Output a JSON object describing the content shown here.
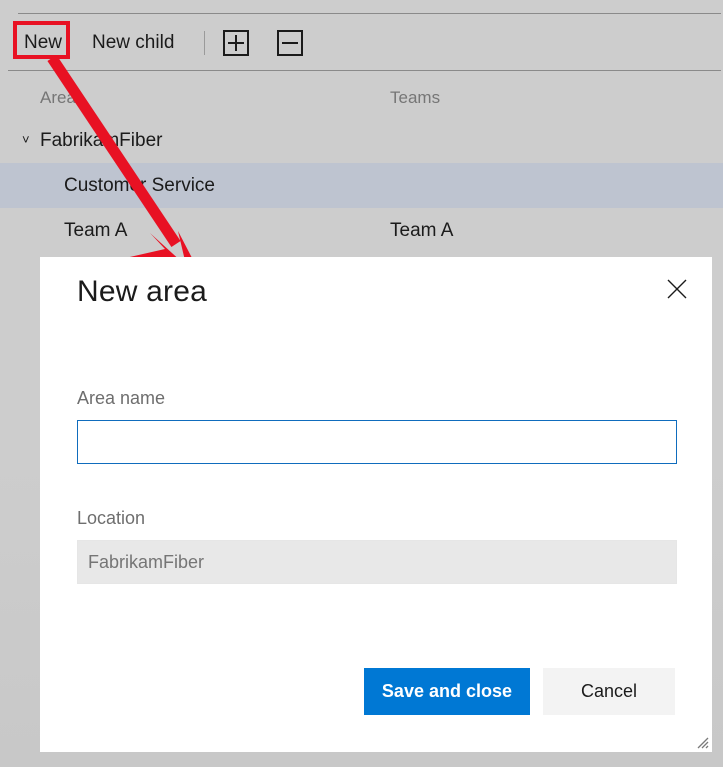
{
  "toolbar": {
    "new_label": "New",
    "new_child_label": "New child",
    "expand_icon": "expand-all-icon",
    "collapse_icon": "collapse-all-icon"
  },
  "grid": {
    "columns": [
      "Area",
      "Teams"
    ],
    "rows": [
      {
        "area": "FabrikamFiber",
        "teams": "",
        "indent": 0,
        "expander": "˅",
        "selected": false
      },
      {
        "area": "Customer Service",
        "teams": "",
        "indent": 1,
        "expander": "",
        "selected": true
      },
      {
        "area": "Team A",
        "teams": "Team A",
        "indent": 2,
        "expander": "",
        "selected": false
      }
    ]
  },
  "dialog": {
    "title": "New area",
    "close_icon": "close-icon",
    "fields": {
      "area_name": {
        "label": "Area name",
        "value": "",
        "placeholder": ""
      },
      "location": {
        "label": "Location",
        "value": "FabrikamFiber",
        "placeholder": "FabrikamFiber"
      }
    },
    "buttons": {
      "primary": "Save and close",
      "secondary": "Cancel"
    },
    "resize_grip_icon": "resize-grip-icon"
  },
  "annotation": {
    "highlight_color": "#e81123",
    "highlight_target": "New",
    "arrow_color": "#e81123"
  },
  "colors": {
    "accent": "#0078d4",
    "input_border_focus": "#0f6cbd",
    "selection": "#bec4d0",
    "app_background": "#cdcdcd"
  }
}
